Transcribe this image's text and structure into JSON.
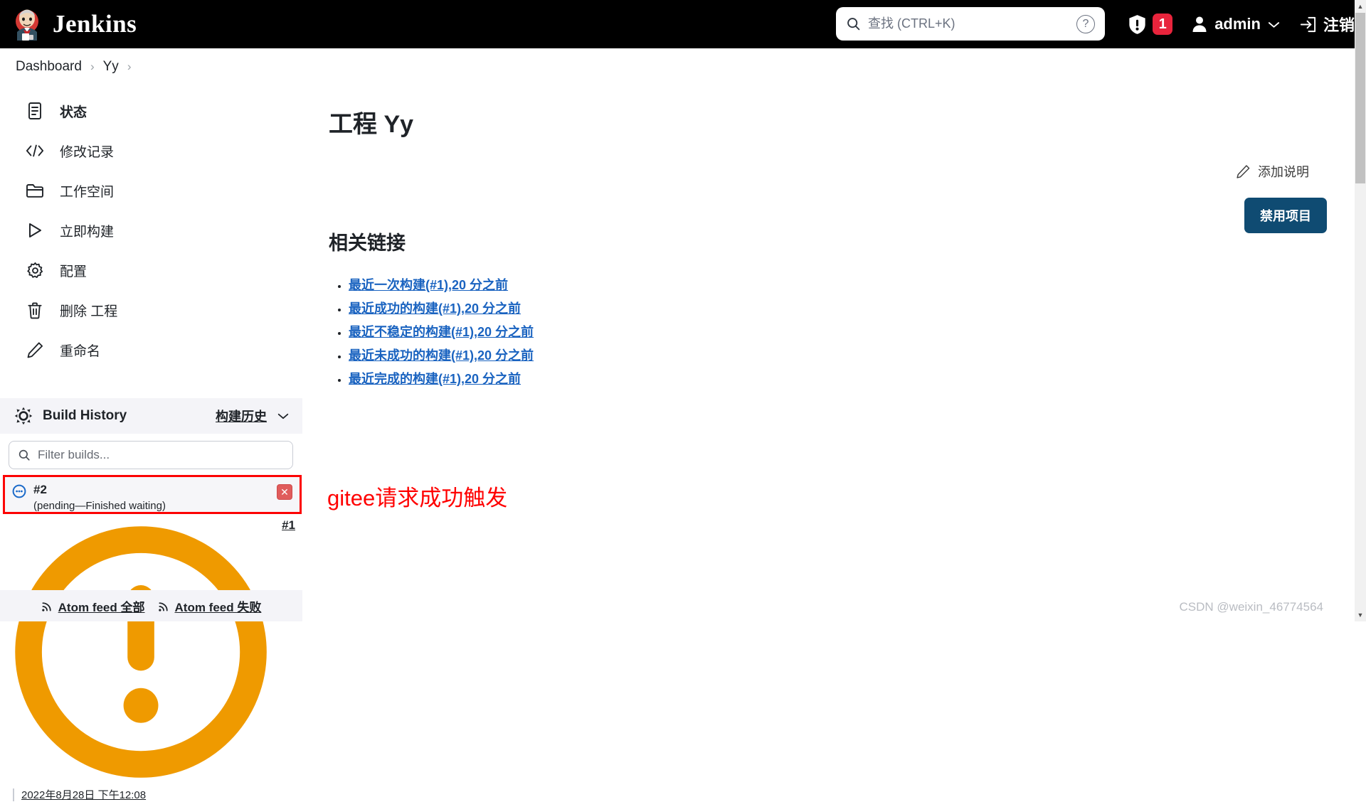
{
  "header": {
    "brand": "Jenkins",
    "logo_icon": "jenkins-butler-logo",
    "search": {
      "placeholder": "查找 (CTRL+K)",
      "value": "",
      "icon": "search-icon",
      "help_icon": "help-circle-icon"
    },
    "alert_icon": "shield-exclamation-icon",
    "alert_count": "1",
    "user_icon": "person-icon",
    "user_name": "admin",
    "user_chevron": "chevron-down-icon",
    "logout_icon": "logout-icon",
    "logout_label": "注销"
  },
  "breadcrumb": {
    "items": [
      "Dashboard",
      "Yy"
    ],
    "separator": "›"
  },
  "sidebar": {
    "items": [
      {
        "label": "状态",
        "icon": "document-icon",
        "active": true
      },
      {
        "label": "修改记录",
        "icon": "code-icon",
        "active": false
      },
      {
        "label": "工作空间",
        "icon": "folder-icon",
        "active": false
      },
      {
        "label": "立即构建",
        "icon": "play-icon",
        "active": false
      },
      {
        "label": "配置",
        "icon": "gear-icon",
        "active": false
      },
      {
        "label": "删除 工程",
        "icon": "trash-icon",
        "active": false
      },
      {
        "label": "重命名",
        "icon": "pencil-icon",
        "active": false
      }
    ]
  },
  "build_history": {
    "weather_icon": "weather-sun-icon",
    "title": "Build History",
    "link_label": "构建历史",
    "chevron": "chevron-down-icon",
    "filter_placeholder": "Filter builds...",
    "filter_value": "",
    "builds": [
      {
        "number": "#2",
        "status_icon": "pending-blue-icon",
        "detail": "(pending—Finished waiting)",
        "cancel_icon": "cancel-x-icon",
        "highlighted": true
      },
      {
        "number": "#1",
        "status_icon": "warning-amber-icon",
        "date": "2022年8月28日 下午12:08",
        "highlighted": false
      }
    ],
    "atom_feeds": [
      {
        "icon": "rss-icon",
        "label": "Atom feed 全部"
      },
      {
        "icon": "rss-icon",
        "label": "Atom feed 失败"
      }
    ]
  },
  "main": {
    "page_title": "工程 Yy",
    "add_description": {
      "icon": "pencil-icon",
      "label": "添加说明"
    },
    "disable_button": "禁用项目",
    "related_links_heading": "相关链接",
    "related_links": [
      "最近一次构建(#1),20 分之前",
      "最近成功的构建(#1),20 分之前",
      "最近不稳定的构建(#1),20 分之前",
      "最近未成功的构建(#1),20 分之前",
      "最近完成的构建(#1),20 分之前"
    ],
    "annotation": "gitee请求成功触发",
    "watermark": "CSDN @weixin_46774564"
  },
  "colors": {
    "header_bg": "#000000",
    "accent_blue": "#1a63c0",
    "button_blue": "#0f4b72",
    "badge_red": "#e8243c",
    "annotation_red": "#ff0000",
    "panel_gray": "#f4f4f8"
  }
}
